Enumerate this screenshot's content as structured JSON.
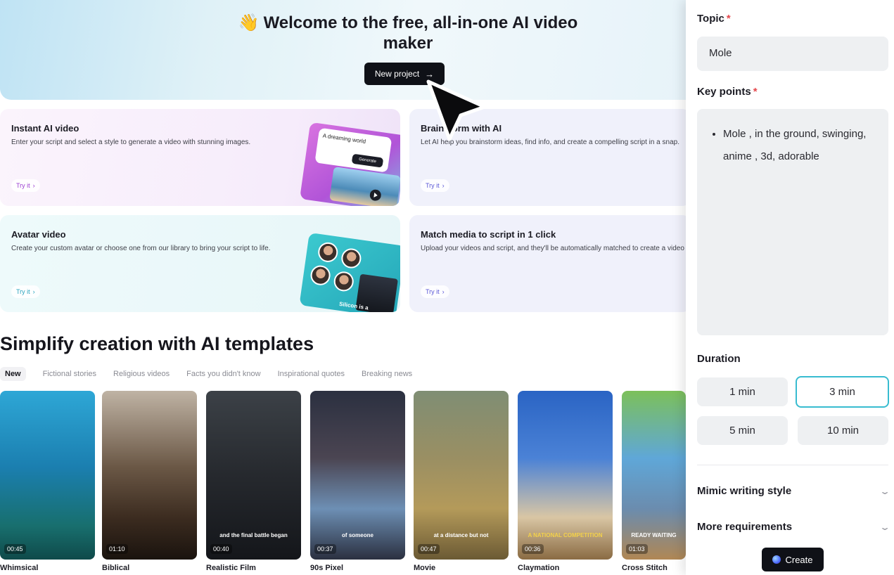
{
  "hero": {
    "wave_emoji": "👋",
    "title": "Welcome to the free, all-in-one AI video maker",
    "new_project_label": "New project",
    "new_project_arrow": "→"
  },
  "cards": {
    "instant": {
      "title": "Instant AI video",
      "desc": "Enter your script and select a style to generate a video with stunning images.",
      "try": "Try it",
      "illus_prompt": "A dreaming world",
      "illus_button": "Generate"
    },
    "brainstorm": {
      "title": "Brainstorm with AI",
      "desc": "Let AI help you brainstorm ideas, find info, and create a compelling script in a snap.",
      "try": "Try it"
    },
    "avatar": {
      "title": "Avatar video",
      "desc": "Create your custom avatar or choose one from our library to bring your script to life.",
      "try": "Try it",
      "illus_caption": "Silicon is a"
    },
    "match": {
      "title": "Match media to script in 1 click",
      "desc": "Upload your videos and script, and they'll be automatically matched to create a video",
      "try": "Try it"
    }
  },
  "templates": {
    "section_title": "Simplify creation with AI templates",
    "tabs": [
      "New",
      "Fictional stories",
      "Religious videos",
      "Facts you didn't know",
      "Inspirational quotes",
      "Breaking news"
    ],
    "items": [
      {
        "name": "Whimsical",
        "duration": "00:45",
        "caption": ""
      },
      {
        "name": "Biblical",
        "duration": "01:10",
        "caption": ""
      },
      {
        "name": "Realistic Film",
        "duration": "00:40",
        "caption": "and the final battle began"
      },
      {
        "name": "90s Pixel",
        "duration": "00:37",
        "caption": "of someone"
      },
      {
        "name": "Movie",
        "duration": "00:47",
        "caption": "at a distance but not"
      },
      {
        "name": "Claymation",
        "duration": "00:36",
        "caption": "A NATIONAL COMPETITION"
      },
      {
        "name": "Cross Stitch",
        "duration": "01:03",
        "caption": "READY WAITING"
      }
    ]
  },
  "panel": {
    "topic_label": "Topic",
    "topic_value": "Mole",
    "keypoints_label": "Key points",
    "keypoints": [
      "Mole , in the ground, swinging, anime , 3d, adorable"
    ],
    "required_mark": "*",
    "duration_label": "Duration",
    "durations": [
      "1 min",
      "3 min",
      "5 min",
      "10 min"
    ],
    "selected_duration": "3 min",
    "mimic_label": "Mimic writing style",
    "more_label": "More requirements",
    "create_label": "Create"
  },
  "colors": {
    "accent": "#38bcd0",
    "dark_button": "#0f1117",
    "required": "#e5484d"
  },
  "icons": [
    "arrow-right-icon",
    "chevron-right-icon",
    "chevron-down-icon",
    "mouse-cursor-icon",
    "play-icon"
  ]
}
